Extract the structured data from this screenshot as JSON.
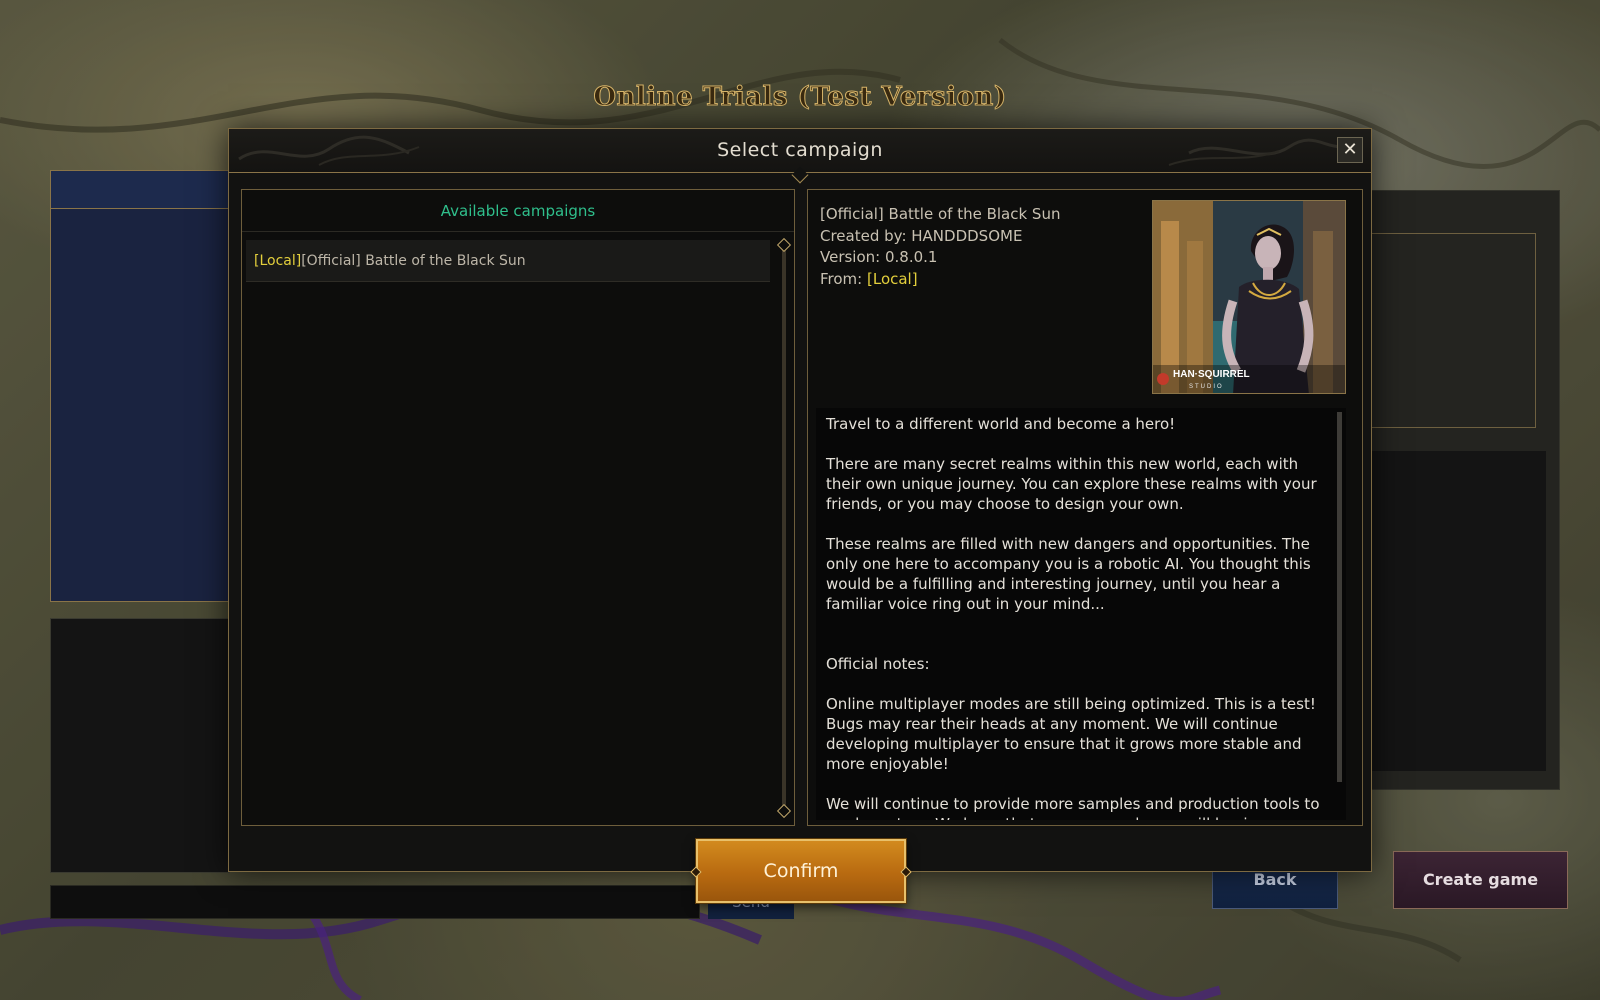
{
  "page": {
    "title": "Online Trials (Test Version)"
  },
  "lobby": {
    "send_label": "Send",
    "back_label": "Back",
    "create_label": "Create game"
  },
  "modal": {
    "title": "Select campaign",
    "close_icon": "close-icon",
    "list": {
      "header": "Available campaigns",
      "items": [
        {
          "tag": "[Local]",
          "name": "[Official] Battle of the Black Sun"
        }
      ]
    },
    "detail": {
      "name": "[Official] Battle of the Black Sun",
      "created_by_label": "Created by: ",
      "created_by": "HANDDDSOME",
      "version_label": "Version: ",
      "version": "0.8.0.1",
      "from_label": "From: ",
      "from": "[Local]",
      "cover_studio": "HAN·SQUIRREL",
      "cover_studio_sub": "STUDIO",
      "description": "Travel to a different world and become a hero!\n\nThere are many secret realms within this new world, each with their own unique journey. You can explore these realms with your friends, or you may choose to design your own.\n\nThese realms are filled with new dangers and opportunities. The only one here to accompany you is a robotic AI. You thought this would be a fulfilling and interesting journey, until you hear a familiar voice ring out in your mind...\n\n\nOfficial notes:\n\nOnline multiplayer modes are still being optimized. This is a test! Bugs may rear their heads at any moment. We will continue developing multiplayer to ensure that it grows more stable and more enjoyable!\n\nWe will continue to provide more samples and production tools to mod creators. We hope that even more players will begin designing their"
    },
    "confirm_label": "Confirm"
  },
  "colors": {
    "accent_green": "#2fbf8c",
    "local_tag_yellow": "#e3cf3c",
    "confirm_orange": "#c4781a",
    "frame_gold": "#8a7448"
  }
}
